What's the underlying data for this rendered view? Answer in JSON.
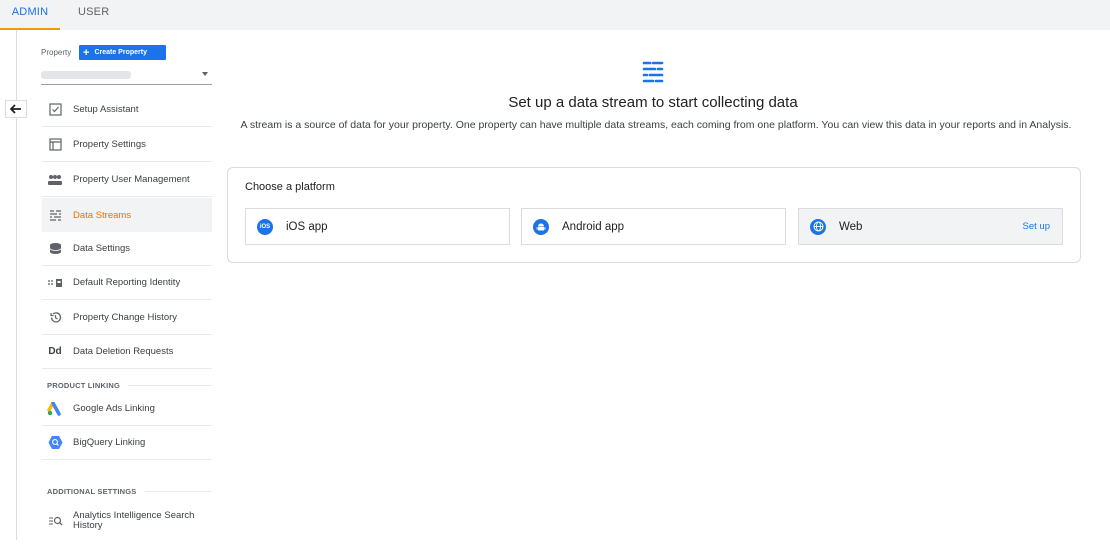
{
  "tabs": {
    "admin": "ADMIN",
    "user": "USER"
  },
  "property": {
    "label": "Property",
    "create_button": "Create Property"
  },
  "nav": {
    "items": [
      {
        "label": "Setup Assistant",
        "icon": "checkbox-icon"
      },
      {
        "label": "Property Settings",
        "icon": "window-icon"
      },
      {
        "label": "Property User Management",
        "icon": "people-icon"
      },
      {
        "label": "Data Streams",
        "icon": "streams-icon"
      },
      {
        "label": "Data Settings",
        "icon": "database-icon"
      },
      {
        "label": "Default Reporting Identity",
        "icon": "identity-icon"
      },
      {
        "label": "Property Change History",
        "icon": "history-icon"
      },
      {
        "label": "Data Deletion Requests",
        "icon": "dd-icon"
      }
    ],
    "product_linking_label": "PRODUCT LINKING",
    "product_linking": [
      {
        "label": "Google Ads Linking",
        "icon": "google-ads-icon"
      },
      {
        "label": "BigQuery Linking",
        "icon": "bigquery-icon"
      }
    ],
    "additional_settings_label": "ADDITIONAL SETTINGS",
    "additional_settings": [
      {
        "label": "Analytics Intelligence Search History",
        "icon": "search-list-icon"
      }
    ],
    "dd_glyph": "Dd"
  },
  "main": {
    "heading": "Set up a data stream to start collecting data",
    "description": "A stream is a source of data for your property. One property can have multiple data streams, each coming from one platform. You can view this data in your reports and in Analysis.",
    "card_title": "Choose a platform",
    "platforms": [
      {
        "label": "iOS app",
        "icon": "ios-icon",
        "glyph": "iOS"
      },
      {
        "label": "Android app",
        "icon": "android-icon"
      },
      {
        "label": "Web",
        "icon": "globe-icon",
        "action": "Set up"
      }
    ]
  },
  "colors": {
    "accent": "#1a73e8",
    "active": "#e8710a",
    "tab_underline": "#f29900"
  }
}
